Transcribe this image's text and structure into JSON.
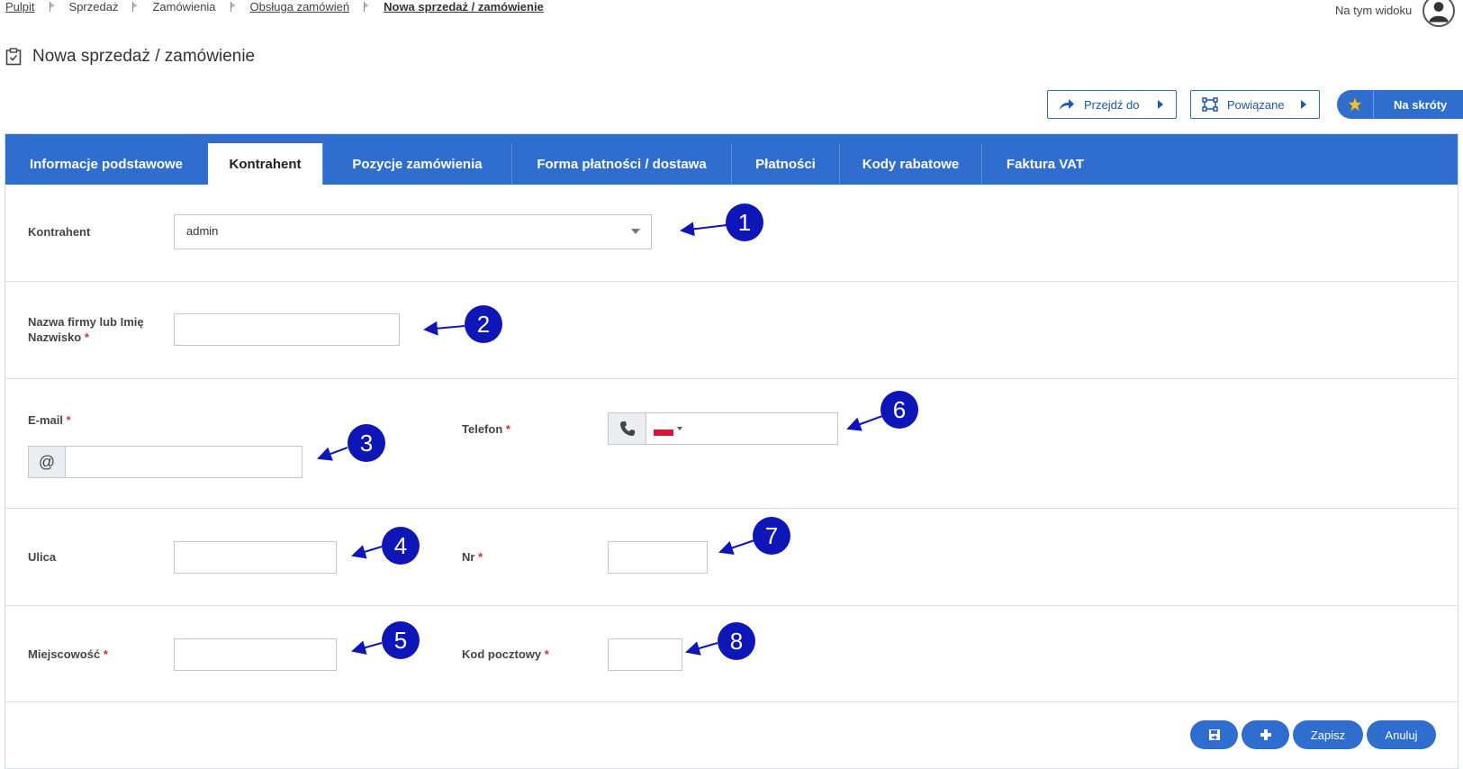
{
  "breadcrumb": [
    "Pulpit",
    "Sprzedaż",
    "Zamówienia",
    "Obsługa zamówień",
    "Nowa sprzedaż / zamówienie"
  ],
  "header": {
    "view_label": "Na tym widoku",
    "title": "Nowa sprzedaż / zamówienie"
  },
  "actions": {
    "goto": "Przejdź do",
    "related": "Powiązane",
    "shortcuts": "Na skróty"
  },
  "tabs": [
    {
      "label": "Informacje podstawowe",
      "active": false
    },
    {
      "label": "Kontrahent",
      "active": true
    },
    {
      "label": "Pozycje zamówienia",
      "active": false
    },
    {
      "label": "Forma płatności / dostawa",
      "active": false
    },
    {
      "label": "Płatności",
      "active": false
    },
    {
      "label": "Kody rabatowe",
      "active": false
    },
    {
      "label": "Faktura VAT",
      "active": false
    }
  ],
  "form": {
    "contractor_label": "Kontrahent",
    "contractor_value": "admin",
    "name_label_line1": "Nazwa firmy lub Imię",
    "name_label_line2": "Nazwisko",
    "email_label": "E-mail",
    "email_addon": "@",
    "phone_label": "Telefon",
    "street_label": "Ulica",
    "number_label": "Nr",
    "city_label": "Miejscowość",
    "postal_label": "Kod pocztowy",
    "required_mark": "*"
  },
  "markers": [
    "1",
    "2",
    "3",
    "4",
    "5",
    "6",
    "7",
    "8"
  ],
  "footer": {
    "save": "Zapisz",
    "cancel": "Anuluj"
  },
  "colors": {
    "accent": "#2f6dcf",
    "marker": "#0f16b8",
    "required": "#d9302c"
  }
}
